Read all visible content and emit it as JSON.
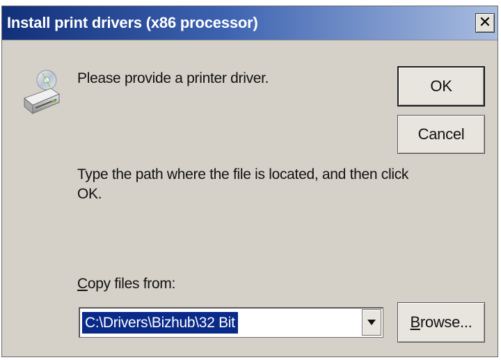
{
  "window": {
    "title": "Install print drivers (x86 processor)",
    "close_glyph": "✕"
  },
  "message": {
    "provide": "Please provide a printer driver.",
    "type_line1": "Type the path where the file is located, and then click",
    "type_line2": "OK."
  },
  "copy_files": {
    "label_mnemonic": "C",
    "label_rest": "opy files from:",
    "value": "C:\\Drivers\\Bizhub\\32 Bit"
  },
  "buttons": {
    "ok": "OK",
    "cancel": "Cancel",
    "browse_mnemonic": "B",
    "browse_rest": "rowse..."
  },
  "icons": {
    "drive": "cd-drive-icon",
    "dropdown": "chevron-down-icon",
    "close": "close-icon"
  },
  "colors": {
    "titlebar_start": "#12307a",
    "titlebar_end": "#a9bde0",
    "dialog_bg": "#d5d1c8",
    "selection": "#0a2a8a"
  }
}
